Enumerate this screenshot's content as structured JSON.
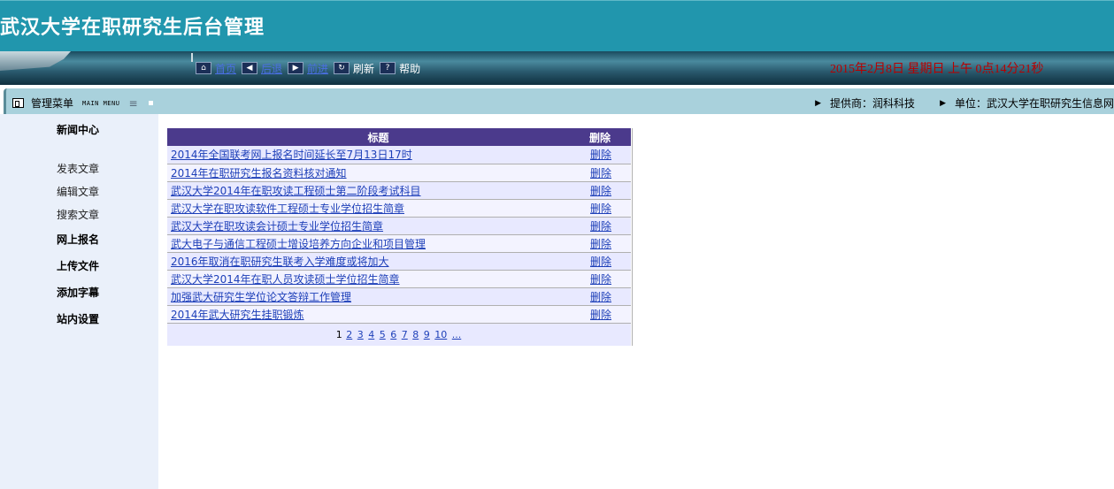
{
  "header": {
    "site_title": "武汉大学在职研究生后台管理",
    "toolbar": [
      {
        "icon": "home-icon",
        "label": "首页",
        "link": true
      },
      {
        "icon": "back-arrow-icon",
        "label": "后退",
        "link": true
      },
      {
        "icon": "forward-arrow-icon",
        "label": "前进",
        "link": true
      },
      {
        "icon": "refresh-icon",
        "label": "刷新",
        "link": false
      },
      {
        "icon": "help-icon",
        "label": "帮助",
        "link": false
      }
    ],
    "clock": "2015年2月8日  星期日  上午  0点14分21秒"
  },
  "menu_bar": {
    "title": "管理菜单",
    "subtitle": "MAIN MENU",
    "provider": "提供商：润科科技",
    "unit": "单位：武汉大学在职研究生信息网"
  },
  "sidebar": {
    "items": [
      {
        "label": "新闻中心",
        "bold": true
      },
      {
        "label": "发表文章",
        "bold": false
      },
      {
        "label": "编辑文章",
        "bold": false
      },
      {
        "label": "搜索文章",
        "bold": false
      },
      {
        "label": "网上报名",
        "bold": true
      },
      {
        "label": "上传文件",
        "bold": true
      },
      {
        "label": "添加字幕",
        "bold": true
      },
      {
        "label": "站内设置",
        "bold": true
      }
    ]
  },
  "news_table": {
    "col_title": "标题",
    "col_delete": "删除",
    "rows": [
      {
        "title": "2014年全国联考网上报名时间延长至7月13日17时",
        "action": "删除"
      },
      {
        "title": "2014年在职研究生报名资料核对通知",
        "action": "删除"
      },
      {
        "title": "武汉大学2014年在职攻读工程硕士第二阶段考试科目",
        "action": "删除"
      },
      {
        "title": "武汉大学在职攻读软件工程硕士专业学位招生简章",
        "action": "删除"
      },
      {
        "title": "武汉大学在职攻读会计硕士专业学位招生简章",
        "action": "删除"
      },
      {
        "title": "武大电子与通信工程硕士增设培养方向企业和项目管理",
        "action": "删除"
      },
      {
        "title": "2016年取消在职研究生联考入学难度或将加大",
        "action": "删除"
      },
      {
        "title": "武汉大学2014年在职人员攻读硕士学位招生简章",
        "action": "删除"
      },
      {
        "title": "加强武大研究生学位论文答辩工作管理",
        "action": "删除"
      },
      {
        "title": "2014年武大研究生挂职锻炼",
        "action": "删除"
      }
    ],
    "pager": {
      "current": "1",
      "pages": [
        "2",
        "3",
        "4",
        "5",
        "6",
        "7",
        "8",
        "9",
        "10"
      ],
      "more": "..."
    }
  }
}
